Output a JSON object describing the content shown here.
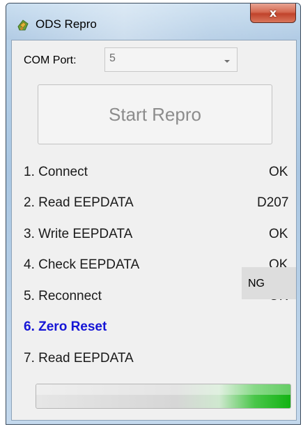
{
  "window": {
    "title": "ODS Repro",
    "close_label": "x"
  },
  "com_port": {
    "label": "COM Port:",
    "value": "5"
  },
  "start_button": {
    "label": "Start Repro",
    "enabled": false
  },
  "steps": [
    {
      "label": "1. Connect",
      "status": "OK"
    },
    {
      "label": "2. Read EEPDATA",
      "status": "D207"
    },
    {
      "label": "3. Write EEPDATA",
      "status": "OK"
    },
    {
      "label": "4. Check EEPDATA",
      "status": "OK"
    },
    {
      "label": "5. Reconnect",
      "status": "OK"
    },
    {
      "label": "6. Zero Reset",
      "status": "NG",
      "active": true
    },
    {
      "label": "7. Read EEPDATA",
      "status": ""
    }
  ],
  "progress": {
    "fraction": 1.0
  },
  "colors": {
    "active_step": "#1515d6",
    "progress_green": "#13b313",
    "close_button": "#c0432b"
  },
  "icons": {
    "app": "app-icon",
    "close": "close-icon",
    "dropdown": "chevron-down-icon"
  }
}
